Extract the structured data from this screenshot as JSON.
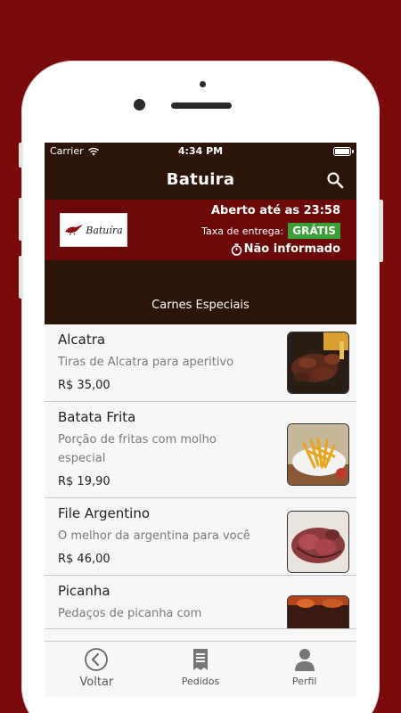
{
  "status": {
    "carrier": "Carrier",
    "time": "4:34 PM"
  },
  "navbar": {
    "title": "Batuira",
    "search_icon": "search-icon"
  },
  "store": {
    "logo_text": "Batuíra",
    "open_text": "Aberto até as 23:58",
    "fee_label": "Taxa de entrega:",
    "fee_badge": "GRÁTIS",
    "time_text": "Não informado"
  },
  "category": {
    "title": "Carnes  Especiais"
  },
  "products": [
    {
      "name": "Alcatra",
      "desc": "Tiras de Alcatra para aperitivo",
      "price": "R$ 35,00",
      "image": "meat-strips"
    },
    {
      "name": "Batata Frita",
      "desc": "Porção de fritas com molho especial",
      "price": "R$ 19,90",
      "image": "fries"
    },
    {
      "name": "File Argentino",
      "desc": "O melhor da argentina para você",
      "price": "R$ 46,00",
      "image": "steak-slices"
    },
    {
      "name": "Picanha",
      "desc": "Pedaços de picanha com",
      "price": "",
      "image": "picanha"
    }
  ],
  "tabs": [
    {
      "label": "Voltar",
      "icon": "back-circle-icon"
    },
    {
      "label": "Pedidos",
      "icon": "receipt-icon"
    },
    {
      "label": "Perfil",
      "icon": "person-icon"
    }
  ],
  "colors": {
    "background": "#7a0a0a",
    "header": "#2c1408",
    "info": "#6b0808",
    "badge": "#3aa035"
  }
}
